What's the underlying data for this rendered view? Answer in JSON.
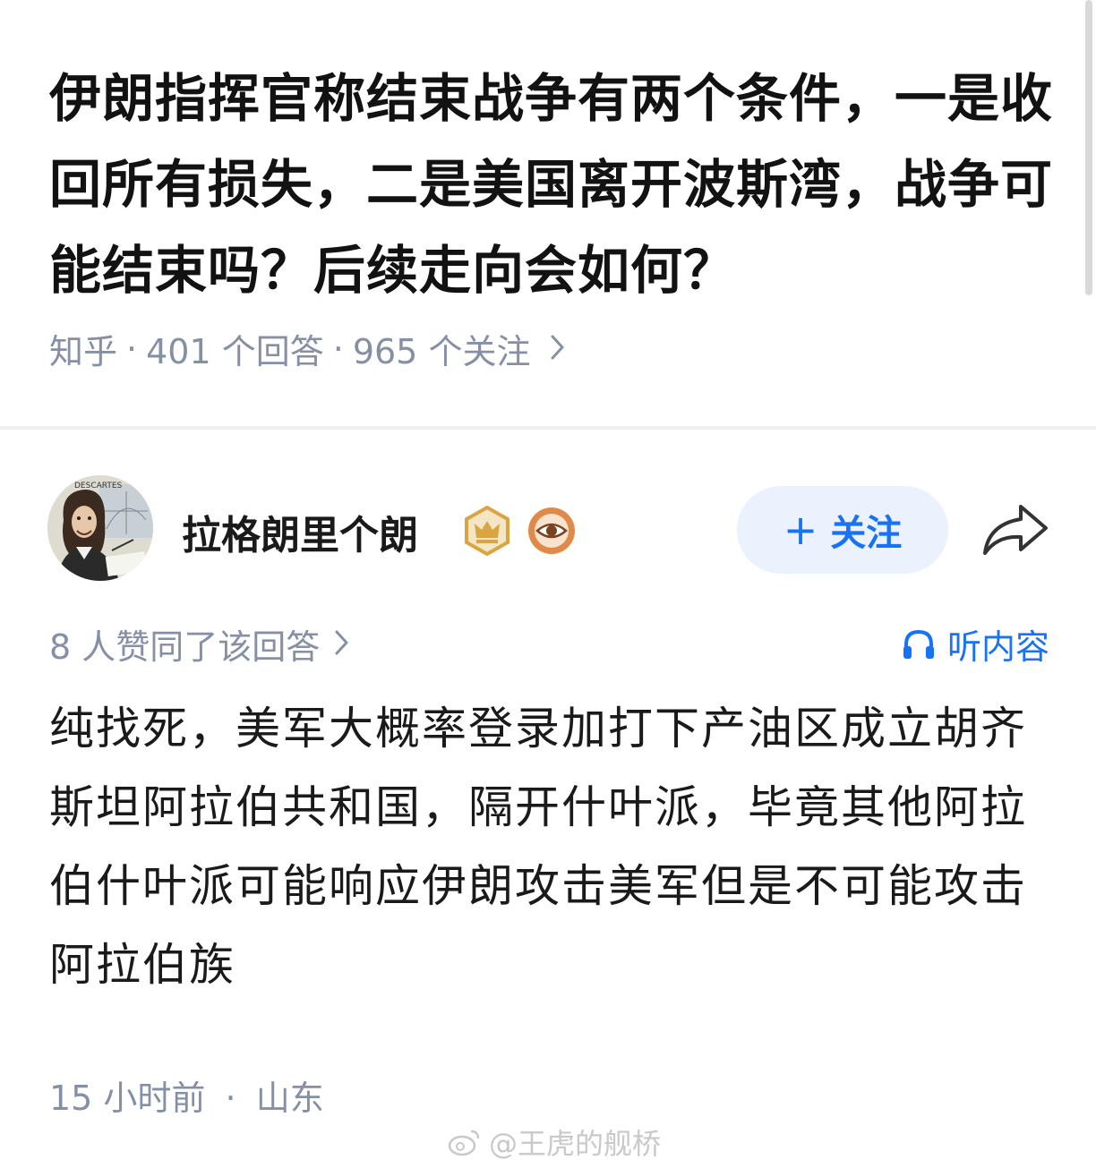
{
  "question": {
    "title": "伊朗指挥官称结束战争有两个条件，一是收回所有损失，二是美国离开波斯湾，战争可能结束吗？后续走向会如何？",
    "source": "知乎",
    "answer_count": "401 个回答",
    "follower_count": "965 个关注",
    "separator": "·",
    "more_icon": "chevron-right-icon"
  },
  "author": {
    "name": "拉格朗里个朗",
    "avatar_icon": "avatar-descartes",
    "avatar_caption": "DESCARTES",
    "badges": [
      "crown-badge-icon",
      "eye-badge-icon"
    ],
    "follow_label": "关注",
    "follow_plus": "+",
    "share_icon": "share-arrow-icon"
  },
  "answer": {
    "upvote_text": "8 人赞同了该回答",
    "listen_label": "听内容",
    "listen_icon": "headphones-icon",
    "body": "纯找死，美军大概率登录加打下产油区成立胡齐斯坦阿拉伯共和国，隔开什叶派，毕竟其他阿拉伯什叶派可能响应伊朗攻击美军但是不可能攻击阿拉伯族",
    "time": "15 小时前",
    "location": "山东"
  },
  "watermark": {
    "text": "@王虎的舰桥",
    "icon": "weibo-icon"
  },
  "colors": {
    "accent": "#1772f6",
    "meta_text": "#8590a6",
    "follow_bg": "#ebf2fe",
    "badge_gold": "#d9a441",
    "badge_orange": "#e08a4a"
  }
}
